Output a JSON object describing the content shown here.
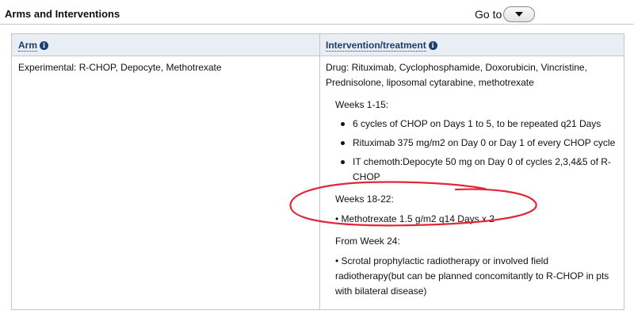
{
  "header": {
    "title": "Arms and Interventions",
    "goto_label": "Go to"
  },
  "table": {
    "columns": [
      {
        "label": "Arm"
      },
      {
        "label": "Intervention/treatment"
      }
    ],
    "row": {
      "arm": "Experimental: R-CHOP, Depocyte, Methotrexate",
      "drug_line_1": "Drug: Rituximab, Cyclophosphamide, Doxorubicin, Vincristine,",
      "drug_line_2": "Prednisolone, liposomal cytarabine, methotrexate",
      "weeks_1_15": "Weeks 1-15:",
      "bullets_1_15": [
        "6 cycles of CHOP on Days 1 to 5, to be repeated q21 Days",
        "Rituximab 375 mg/m2 on Day 0 or Day 1 of every CHOP cycle",
        "IT chemoth:Depocyte 50 mg on Day 0 of cycles 2,3,4&5 of R-CHOP"
      ],
      "weeks_18_22": "Weeks 18-22:",
      "methotrexate": "• Methotrexate 1.5 g/m2 q14 Days x 2",
      "from_week_24": "From Week 24:",
      "radiotherapy": "• Scrotal prophylactic radiotherapy or involved field radiotherapy(but can be planned concomitantly to R-CHOP in pts with bilateral disease)"
    }
  },
  "annotation": {
    "color": "#e0283a"
  },
  "icons": {
    "info": "info-icon",
    "dropdown": "chevron-down-icon"
  }
}
